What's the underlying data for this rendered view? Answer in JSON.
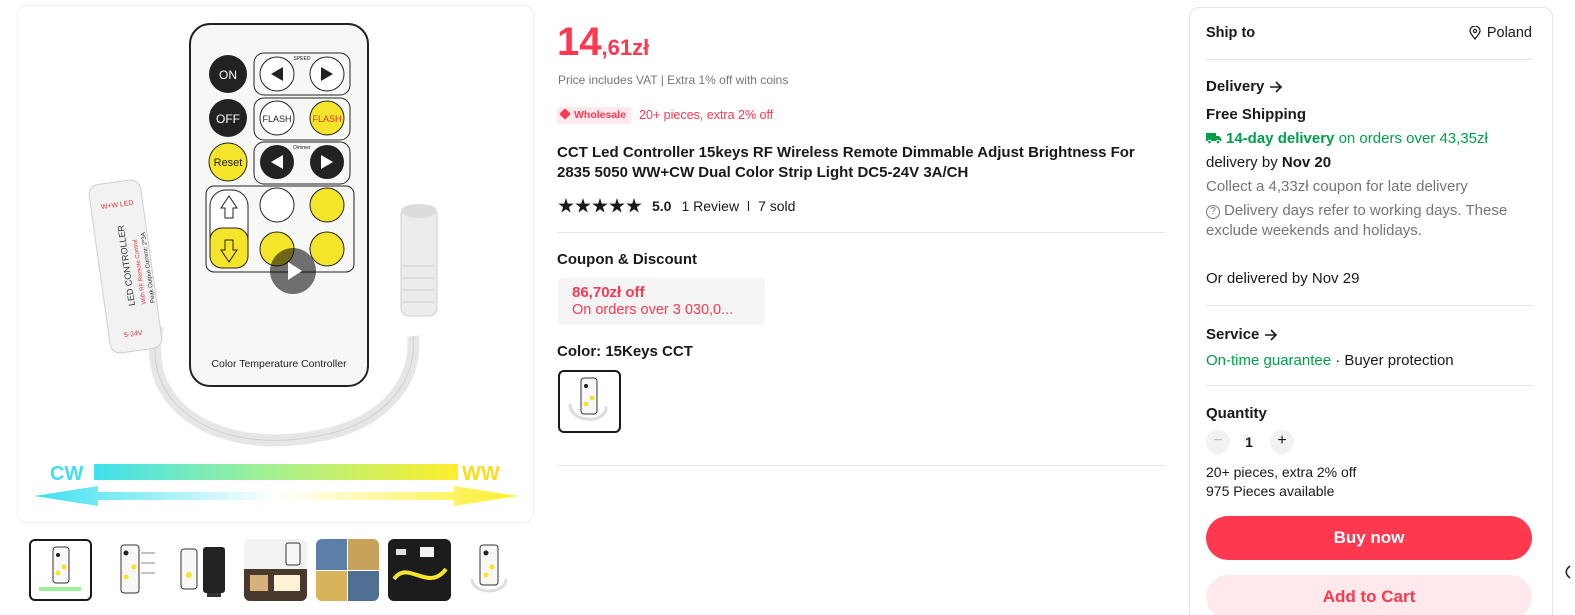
{
  "price": {
    "integer": "14",
    "decimal": ",61zł"
  },
  "price_note": "Price includes VAT | Extra 1% off with coins",
  "wholesale": {
    "badge": "Wholesale",
    "text": "20+ pieces, extra 2% off"
  },
  "title": "CCT Led Controller 15keys RF Wireless Remote Dimmable Adjust Brightness For 2835 5050 WW+CW Dual Color Strip Light DC5-24V 3A/CH",
  "rating": {
    "score": "5.0",
    "reviews": "1 Review",
    "sold": "7 sold",
    "stars": 5
  },
  "coupon": {
    "section": "Coupon & Discount",
    "amount": "86,70zł off",
    "condition": "On orders over 3 030,0..."
  },
  "color": {
    "label": "Color: 15Keys CCT"
  },
  "product_image": {
    "remote_labels": {
      "on": "ON",
      "off": "OFF",
      "reset": "Reset",
      "flash": "FLASH",
      "speed": "SPEED",
      "dimmer": "Dimmer",
      "footer": "Color Temperature Controller"
    },
    "controller_labels": {
      "brand": "W+W LED",
      "model": "LED CONTROLLER",
      "sub": "With RF Remote Control",
      "spec": "Peak Output Current: 2*3A",
      "volt": "5-24V"
    },
    "cw": "CW",
    "ww": "WW"
  },
  "panel": {
    "ship_to": "Ship to",
    "country": "Poland",
    "delivery_head": "Delivery",
    "free_shipping": "Free Shipping",
    "fast_delivery": "14-day delivery",
    "fast_delivery_cond": "on orders over 43,35zł",
    "delivery_by_prefix": "delivery by",
    "delivery_date": "Nov 20",
    "coupon_late": "Collect a 4,33zł coupon for late delivery",
    "working_days_1": "Delivery days refer to working days. These",
    "working_days_2": "exclude weekends and holidays.",
    "alt_delivery": "Or delivered by Nov 29",
    "service_head": "Service",
    "on_time": "On-time guarantee",
    "dot": "·",
    "buyer_protection": "Buyer protection",
    "quantity_head": "Quantity",
    "quantity": "1",
    "minus": "−",
    "plus": "+",
    "bulk_note": "20+ pieces, extra 2% off",
    "available": "975 Pieces available",
    "buy_now": "Buy now",
    "add_to_cart": "Add to Cart"
  },
  "colors": {
    "accent": "#fd384f",
    "green": "#00a04a",
    "text": "#191919",
    "muted": "#757575"
  }
}
